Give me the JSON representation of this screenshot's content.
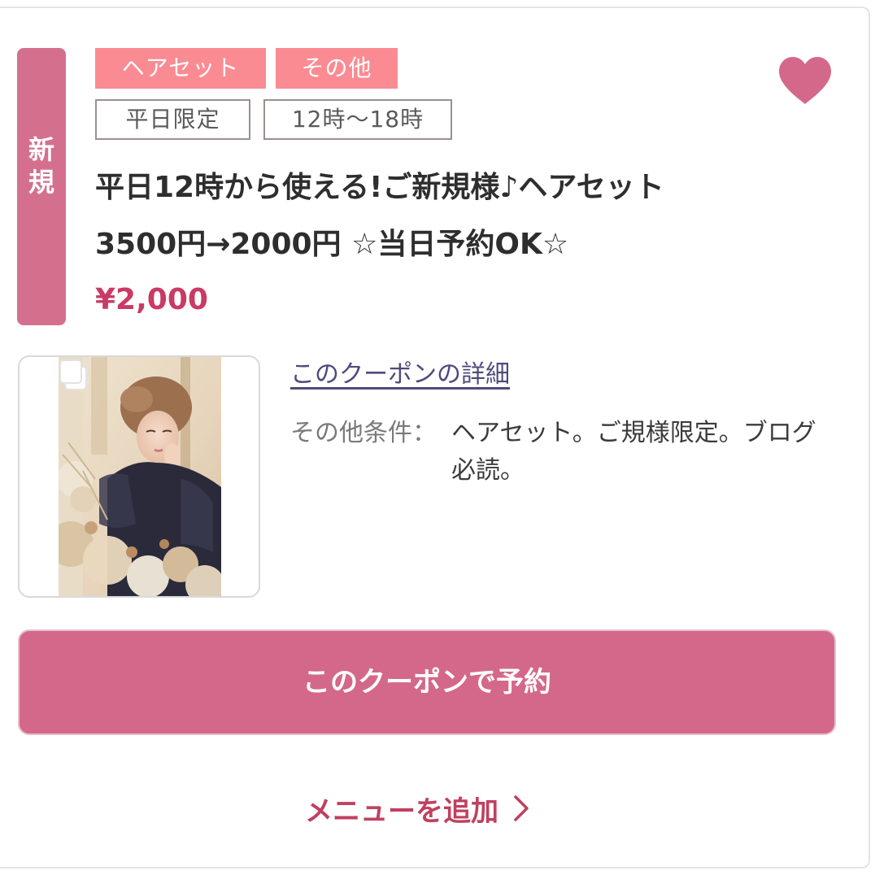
{
  "ribbon": {
    "line1": "新",
    "line2": "規"
  },
  "tags": {
    "menu_type": "ヘアセット",
    "other": "その他",
    "availability": "平日限定",
    "time": "12時〜18時"
  },
  "coupon": {
    "title": "平日12時から使える!ご新規様♪ヘアセット3500円→2000円 ☆当日予約OK☆",
    "price": "¥2,000",
    "detail_link": "このクーポンの詳細",
    "conditions_label": "その他条件：",
    "conditions_value": "ヘアセット。ご規様限定。ブログ必読。"
  },
  "actions": {
    "reserve": "このクーポンで予約",
    "add_menu": "メニューを追加"
  },
  "icons": {
    "favorite": "heart-icon",
    "gallery": "gallery-stack-icon",
    "chevron": "chevron-right-icon"
  },
  "colors": {
    "accent": "#d4688a",
    "tag_pink": "#fb8b93",
    "price": "#c93a64",
    "link": "#4f4a7c"
  }
}
